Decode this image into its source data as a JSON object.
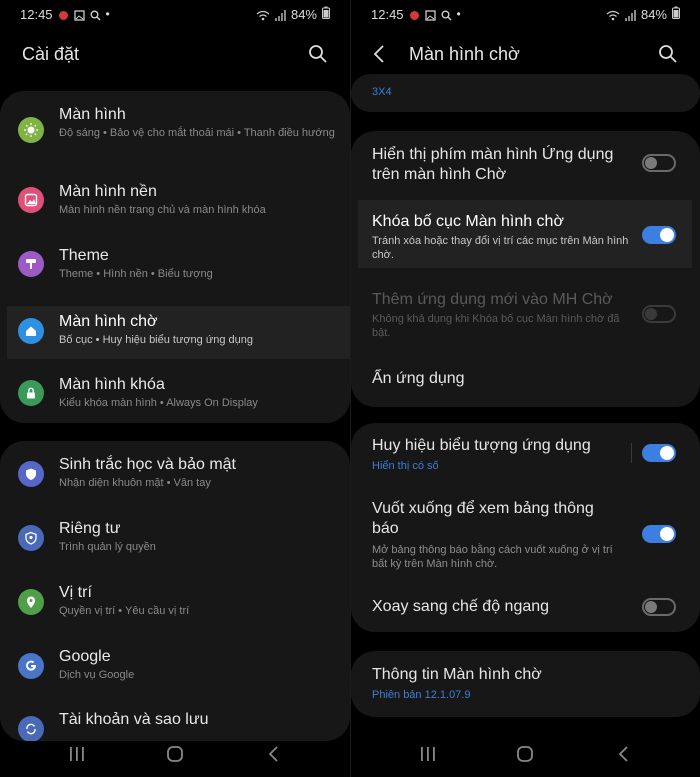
{
  "status": {
    "time": "12:45",
    "battery": "84%"
  },
  "left": {
    "header": {
      "title": "Cài đặt"
    },
    "group1": [
      {
        "title": "Màn hình",
        "sub": "Độ sáng  •  Bảo vệ cho mắt thoải mái  •  Thanh điều hướng",
        "icon": "sun-icon",
        "color": "#7fb343"
      },
      {
        "title": "Màn hình nền",
        "sub": "Màn hình nền trang chủ và màn hình khóa",
        "icon": "wallpaper-icon",
        "color": "#e0507a"
      },
      {
        "title": "Theme",
        "sub": "Theme  •  Hình nền  •  Biểu tượng",
        "icon": "theme-icon",
        "color": "#9b5ac4"
      },
      {
        "title": "Màn hình chờ",
        "sub": "Bố cục  •  Huy hiệu biểu tượng ứng dụng",
        "icon": "home-icon",
        "color": "#2f8fe0"
      },
      {
        "title": "Màn hình khóa",
        "sub": "Kiểu khóa màn hình  •  Always On Display",
        "icon": "lock-icon",
        "color": "#3a9a5a"
      }
    ],
    "group2": [
      {
        "title": "Sinh trắc học và bảo mật",
        "sub": "Nhận diện khuôn mặt  •  Vân tay",
        "icon": "shield-icon",
        "color": "#5666c9"
      },
      {
        "title": "Riêng tư",
        "sub": "Trình quản lý quyền",
        "icon": "privacy-icon",
        "color": "#4a6ab8"
      },
      {
        "title": "Vị trí",
        "sub": "Quyền vị trí  •  Yêu cầu vị trí",
        "icon": "location-icon",
        "color": "#4f9e48"
      },
      {
        "title": "Google",
        "sub": "Dịch vụ Google",
        "icon": "google-icon",
        "color": "#4a74c8"
      },
      {
        "title": "Tài khoản và sao lưu",
        "sub": "",
        "icon": "sync-icon",
        "color": "#4a6ab8"
      }
    ]
  },
  "right": {
    "header": {
      "title": "Màn hình chờ"
    },
    "top_partial": "3X4",
    "group1": {
      "show_apps_button": "Hiển thị phím màn hình Ứng dụng trên màn hình Chờ",
      "lock_layout_title": "Khóa bố cục Màn hình chờ",
      "lock_layout_sub": "Tránh xóa hoặc thay đổi vị trí các mục trên Màn hình chờ.",
      "add_apps_title": "Thêm ứng dụng mới vào MH Chờ",
      "add_apps_sub": "Không khả dụng khi Khóa bố cục Màn hình chờ đã bật.",
      "hide_apps": "Ẩn ứng dụng"
    },
    "group2": {
      "badges_title": "Huy hiệu biểu tượng ứng dụng",
      "badges_sub": "Hiển thị có số",
      "swipe_title": "Vuốt xuống để xem bảng thông báo",
      "swipe_sub": "Mở bảng thông báo bằng cách vuốt xuống ở vị trí bất kỳ trên Màn hình chờ.",
      "rotate_title": "Xoay sang chế độ ngang"
    },
    "group3": {
      "about_title": "Thông tin Màn hình chờ",
      "about_version": "Phiên bản 12.1.07.9"
    }
  }
}
